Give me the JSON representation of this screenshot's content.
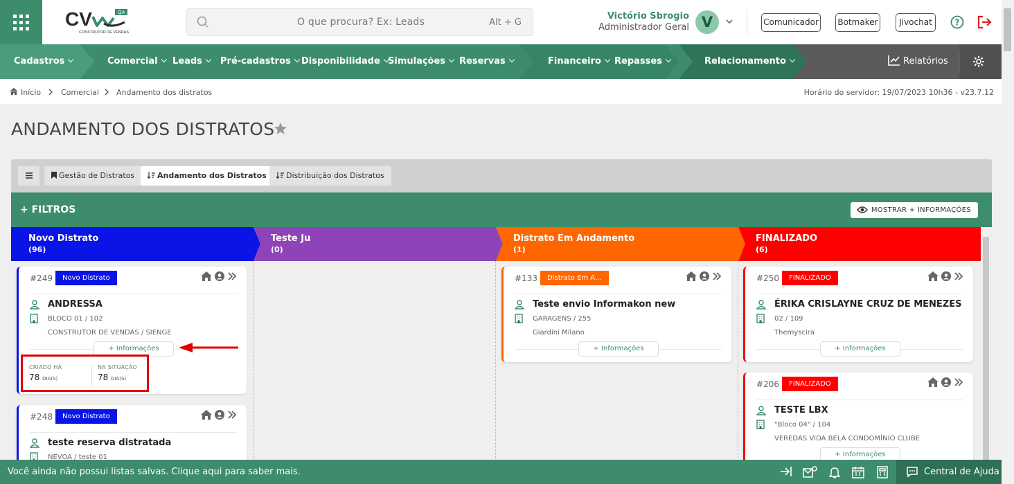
{
  "header": {
    "logo_text": "CV",
    "logo_tag": "QA",
    "logo_subtitle": "CONSTRUTOR DE VENDAS",
    "search_placeholder": "O que procura? Ex: Leads",
    "search_shortcut": "Alt + G",
    "user_name": "Victório Sbrogio",
    "user_role": "Administrador Geral",
    "avatar_letter": "V",
    "buttons": [
      "Comunicador",
      "Botmaker",
      "Jivochat"
    ]
  },
  "nav": {
    "items": [
      "Cadastros",
      "Comercial",
      "Leads",
      "Pré-cadastros",
      "Disponibilidade",
      "Simulações",
      "Reservas",
      "Financeiro",
      "Repasses",
      "Relacionamento"
    ],
    "reports": "Relatórios"
  },
  "breadcrumb": {
    "items": [
      "Início",
      "Comercial",
      "Andamento dos distratos"
    ],
    "server_time": "Horário do servidor: 19/07/2023 10h36 - v23.7.12"
  },
  "page": {
    "title": "ANDAMENTO DOS DISTRATOS",
    "tabs": [
      "Gestão de Distratos",
      "Andamento dos Distratos",
      "Distribuição dos Distratos"
    ],
    "filters_label": "+ FILTROS",
    "more_info_label": "MOSTRAR + INFORMAÇÕES"
  },
  "columns": [
    {
      "title": "Novo Distrato",
      "count": "(96)",
      "color": "#0a14e6"
    },
    {
      "title": "Teste Ju",
      "count": "(0)",
      "color": "#8e44b8"
    },
    {
      "title": "Distrato Em Andamento",
      "count": "(1)",
      "color": "#ff6600"
    },
    {
      "title": "FINALIZADO",
      "count": "(6)",
      "color": "#ff0000"
    }
  ],
  "cards": [
    {
      "num": "#249",
      "badge": "Novo Distrato",
      "name": "ANDRESSA",
      "unit": "BLOCO 01 / 102",
      "dev": "CONSTRUTOR DE VENDAS / SIENGE",
      "info": "+ Informações"
    },
    {
      "num": "#248",
      "badge": "Novo Distrato",
      "name": "teste reserva distratada",
      "unit": "NEVOA / teste 01"
    },
    {
      "num": "#133",
      "badge": "Distrato Em A...",
      "name": "Teste envio Informakon new",
      "unit": "GARAGENS / 255",
      "dev": "Giardini Milano",
      "info": "+ Informações"
    },
    {
      "num": "#250",
      "badge": "FINALIZADO",
      "name": "ÉRIKA CRISLAYNE CRUZ DE MENEZES",
      "unit": "02 / 109",
      "dev": "Themyscira",
      "info": "+ Informações"
    },
    {
      "num": "#206",
      "badge": "FINALIZADO",
      "name": "TESTE LBX",
      "unit": "\"Bloco 04\" / 104",
      "dev": "VEREDAS VIDA BELA CONDOMÍNIO CLUBE",
      "info": "+ Informações"
    }
  ],
  "stats": {
    "created_label": "CRIADO HÁ",
    "created_value": "78",
    "situation_label": "NA SITUAÇÃO",
    "situation_value": "78",
    "unit": "DIA(S)"
  },
  "footer": {
    "message": "Você ainda não possui listas salvas. Clique aqui para saber mais.",
    "help_center": "Central de Ajuda"
  }
}
